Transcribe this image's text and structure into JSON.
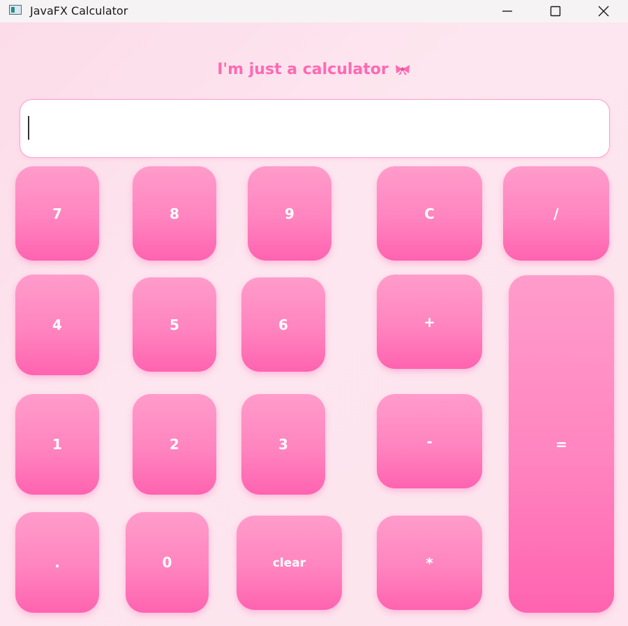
{
  "window": {
    "title": "JavaFX Calculator",
    "controls": [
      "minimize-icon",
      "maximize-icon",
      "close-icon"
    ]
  },
  "app": {
    "heading": "I'm just a calculator",
    "heading_icon": "ribbon-bow-icon",
    "display": {
      "value": "",
      "placeholder": ""
    }
  },
  "keys": {
    "k7": "7",
    "k8": "8",
    "k9": "9",
    "kC": "C",
    "kDiv": "/",
    "k4": "4",
    "k5": "5",
    "k6": "6",
    "kPlus": "+",
    "kEq": "=",
    "k1": "1",
    "k2": "2",
    "k3": "3",
    "kMinus": "-",
    "kDot": ".",
    "k0": "0",
    "kClear": "clear",
    "kMul": "*"
  },
  "colors": {
    "accent": "#ff69b4",
    "button_top": "#ff9ccb",
    "button_bottom": "#ff63b0",
    "background": "#fde4ee",
    "display_border": "#ff9fcc"
  }
}
